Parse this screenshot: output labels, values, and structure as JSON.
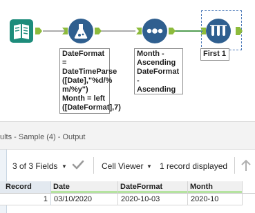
{
  "workflow": {
    "formula_tool": {
      "annotation": [
        "DateFormat =",
        "DateTimeParse",
        "([Date],\"%d/%",
        "m/%y\")",
        "Month = left",
        "([DateFormat],7)"
      ]
    },
    "sort_tool": {
      "annotation": [
        "Month -",
        "Ascending",
        "DateFormat -",
        "Ascending"
      ]
    },
    "sample_tool": {
      "annotation": [
        "First 1"
      ]
    }
  },
  "results": {
    "title": "ults - Sample (4) - Output",
    "fields_label": "3 of 3 Fields",
    "viewer_label": "Cell Viewer",
    "records_label": "1 record displayed",
    "columns": [
      "Record",
      "Date",
      "DateFormat",
      "Month"
    ],
    "rows": [
      [
        "1",
        "03/10/2020",
        "2020-10-03",
        "2020-10"
      ]
    ]
  },
  "colors": {
    "connection_dark": "#7a7a7a",
    "connection_selected": "#3a8f3a",
    "anchor_green": "#8dbb3c",
    "input_tool_teal": "#1d8c7b",
    "formula_tool_blue": "#2f5f8f",
    "sort_tool_blue": "#2f5f8f",
    "sample_tool_blue": "#2f5f8f",
    "header_underline": "#b5e3a0"
  },
  "icons": {
    "input_tool": "book-icon",
    "formula_tool": "flask-icon",
    "sort_tool": "dots-icon",
    "sample_tool": "test-tubes-icon"
  }
}
